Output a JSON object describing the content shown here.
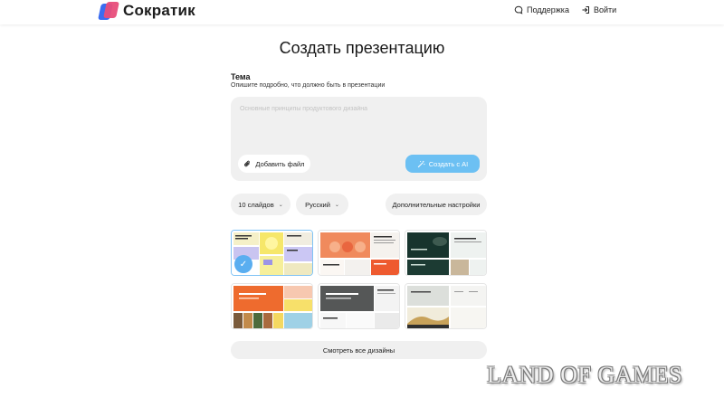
{
  "header": {
    "brand": "Сократик",
    "support": "Поддержка",
    "login": "Войти"
  },
  "page": {
    "title": "Создать презентацию",
    "topic_label": "Тема",
    "topic_hint": "Опишите подробно, что должно быть в презентации",
    "prompt_placeholder": "Основные принципы продуктового дизайна",
    "add_file": "Добавить файл",
    "create_ai": "Создать с AI"
  },
  "options": {
    "slides": "10 слайдов",
    "language": "Русский",
    "advanced": "Дополнительные настройки"
  },
  "designs": {
    "view_all": "Смотреть все дизайны",
    "selected_index": 0
  },
  "watermark": "LAND OF GAMES",
  "colors": {
    "accent": "#6cc0f3",
    "check": "#5aaef0",
    "pill_bg": "#f0f0f0"
  }
}
